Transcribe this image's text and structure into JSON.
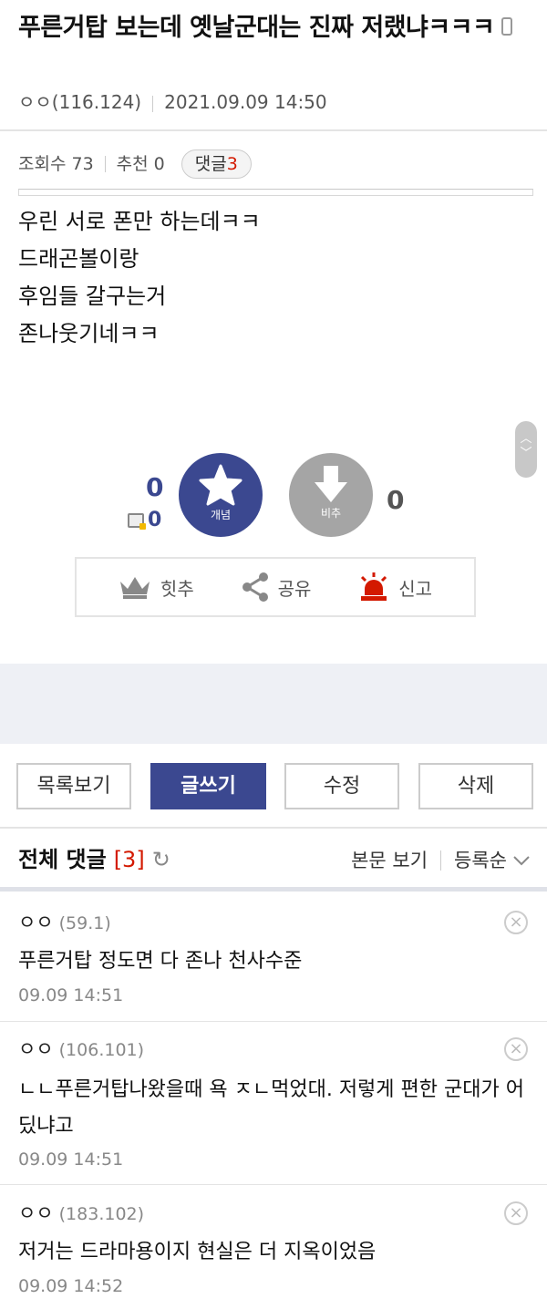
{
  "post": {
    "title": "푸른거탑 보는데 옛날군대는 진짜 저랬냐ㅋㅋㅋ",
    "author": "ㅇㅇ(116.124)",
    "date": "2021.09.09 14:50",
    "views_label": "조회수 73",
    "recommend_label": "추천 0",
    "comment_badge_label": "댓글",
    "comment_badge_count": "3",
    "body": [
      "우린 서로 폰만 하는데ㅋㅋ",
      "드래곤볼이랑",
      "후임들 갈구는거",
      "존나웃기네ㅋㅋ"
    ]
  },
  "votes": {
    "up_count": "0",
    "up_mobile_count": "0",
    "up_label": "개념",
    "down_label": "비추",
    "down_count": "0"
  },
  "actions": {
    "hitchu": "힛추",
    "share": "공유",
    "report": "신고"
  },
  "buttons": {
    "list": "목록보기",
    "write": "글쓰기",
    "edit": "수정",
    "delete": "삭제"
  },
  "comments_header": {
    "title": "전체 댓글",
    "count": "[3]",
    "view_body": "본문 보기",
    "sort": "등록순"
  },
  "comments": [
    {
      "nick": "ㅇㅇ",
      "ip": "(59.1)",
      "text": "푸른거탑 정도면 다 존나 천사수준",
      "time": "09.09 14:51"
    },
    {
      "nick": "ㅇㅇ",
      "ip": "(106.101)",
      "text": "ㄴㄴ푸른거탑나왔을때 욕 ㅈㄴ먹었대. 저렇게 편한 군대가 어딨냐고",
      "time": "09.09 14:51"
    },
    {
      "nick": "ㅇㅇ",
      "ip": "(183.102)",
      "text": "저거는 드라마용이지 현실은 더 지옥이었음",
      "time": "09.09 14:52"
    }
  ],
  "colors": {
    "brand": "#3b4890",
    "accent_red": "#d31900",
    "downvote_gray": "#a5a5a5"
  }
}
